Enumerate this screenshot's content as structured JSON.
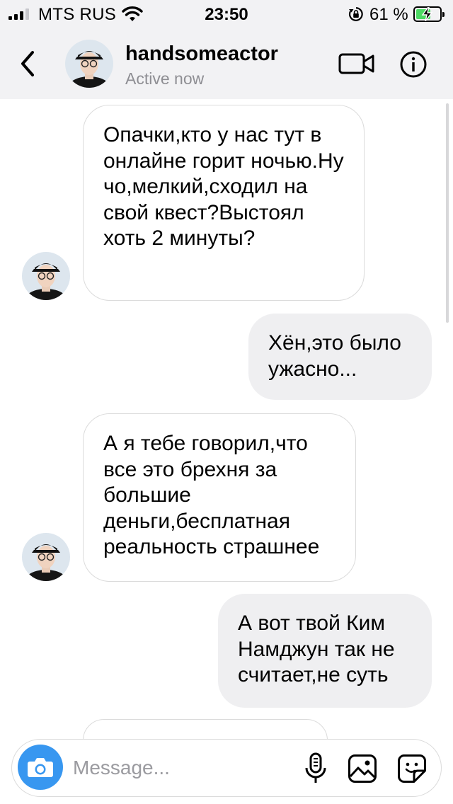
{
  "status_bar": {
    "carrier": "MTS RUS",
    "time": "23:50",
    "battery_percent": "61 %",
    "battery_level": 0.61,
    "icons": [
      "signal-icon",
      "wifi-icon",
      "orientation-lock-icon",
      "battery-charging-icon"
    ]
  },
  "header": {
    "username": "handsomeactor",
    "presence": "Active now",
    "icons": [
      "back-chevron-icon",
      "video-call-icon",
      "info-icon"
    ]
  },
  "messages": [
    {
      "direction": "incoming",
      "text": "Опачки,кто у нас тут в онлайне горит ночью.Ну чо,мелкий,сходил на свой квест?Выстоял хоть 2 минуты?"
    },
    {
      "direction": "outgoing",
      "text": "Хён,это было ужасно..."
    },
    {
      "direction": "incoming",
      "text": "А я тебе говорил,что все это брехня за большие деньги,бесплатная реальность страшнее"
    },
    {
      "direction": "outgoing",
      "text": "А вот твой Ким Намджун так не считает,не суть"
    }
  ],
  "composer": {
    "placeholder": "Message...",
    "icons": [
      "camera-icon",
      "microphone-icon",
      "gallery-icon",
      "sticker-icon"
    ]
  },
  "colors": {
    "accent": "#3897f0",
    "header_bg": "#f2f2f4",
    "outgoing_bubble": "#efeff1",
    "incoming_border": "#dbdbdb",
    "muted_text": "#8e8e93",
    "battery_green": "#4cd964"
  }
}
